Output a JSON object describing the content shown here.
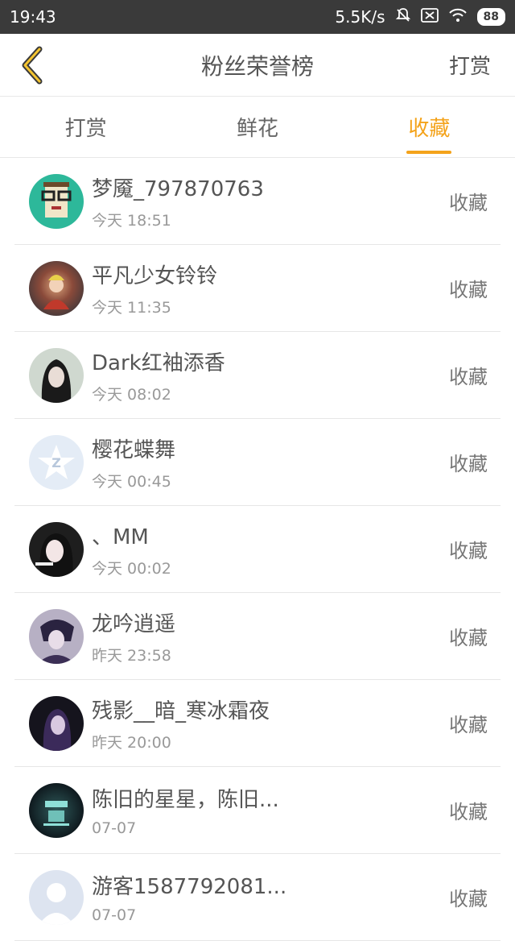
{
  "status_bar": {
    "time": "19:43",
    "speed": "5.5K/s",
    "battery": "88"
  },
  "nav": {
    "title": "粉丝荣誉榜",
    "action": "打赏"
  },
  "tabs": [
    {
      "label": "打赏"
    },
    {
      "label": "鲜花"
    },
    {
      "label": "收藏"
    }
  ],
  "accent_color": "#f4a31b",
  "items": [
    {
      "name": "梦魇_797870763",
      "time": "今天 18:51",
      "action": "收藏"
    },
    {
      "name": "平凡少女铃铃",
      "time": "今天 11:35",
      "action": "收藏"
    },
    {
      "name": "Dark红袖添香",
      "time": "今天 08:02",
      "action": "收藏"
    },
    {
      "name": "樱花蝶舞",
      "time": "今天 00:45",
      "action": "收藏"
    },
    {
      "name": "、MM",
      "time": "今天 00:02",
      "action": "收藏"
    },
    {
      "name": "龙吟逍遥",
      "time": "昨天 23:58",
      "action": "收藏"
    },
    {
      "name": "残影__暗_寒冰霜夜",
      "time": "昨天 20:00",
      "action": "收藏"
    },
    {
      "name": "陈旧的星星，陈旧...",
      "time": "07-07",
      "action": "收藏"
    },
    {
      "name": "游客1587792081...",
      "time": "07-07",
      "action": "收藏"
    }
  ]
}
